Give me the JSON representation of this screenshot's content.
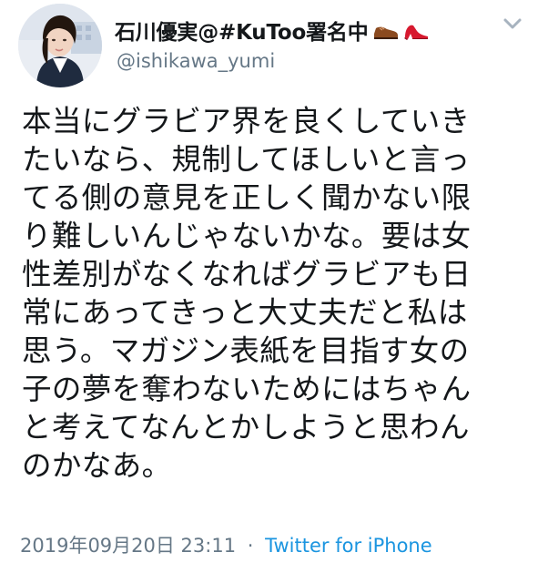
{
  "tweet": {
    "display_name": "石川優実@#KuToo署名中",
    "username": "@ishikawa_yumi",
    "text_lines": [
      "本当にグラビア界を良くしていき",
      "たいなら、規制してほしいと言っ",
      "てる側の意見を正しく聞かない限",
      "り難しいんじゃないかな。要は女",
      "性差別がなくなればグラビアも日",
      "常にあってきっと大丈夫だと私は",
      "思う。マガジン表紙を目指す女の",
      "子の夢を奪わないためにはちゃん",
      "と考えてなんとかしようと思わん",
      "のかなあ。"
    ],
    "timestamp": "2019年09月20日 23:11",
    "separator": "·",
    "source": "Twitter for iPhone"
  },
  "icons": {
    "emoji_1": "mans-shoe-icon",
    "emoji_2": "high-heel-icon",
    "menu": "chevron-down-icon"
  },
  "colors": {
    "text": "#14171a",
    "secondary_text": "#657786",
    "link": "#1b95e0"
  }
}
